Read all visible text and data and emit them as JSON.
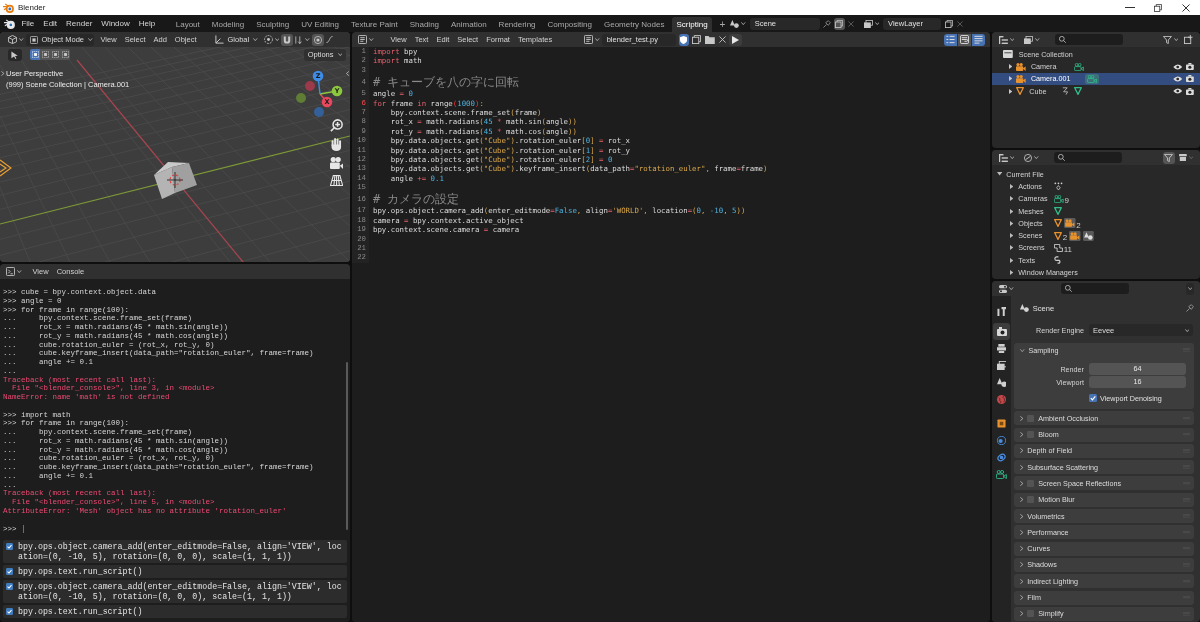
{
  "window": {
    "title": "Blender"
  },
  "menu": [
    "File",
    "Edit",
    "Render",
    "Window",
    "Help"
  ],
  "workspaces": [
    {
      "label": "Layout",
      "selected": false
    },
    {
      "label": "Modeling",
      "selected": false
    },
    {
      "label": "Sculpting",
      "selected": false
    },
    {
      "label": "UV Editing",
      "selected": false
    },
    {
      "label": "Texture Paint",
      "selected": false
    },
    {
      "label": "Shading",
      "selected": false
    },
    {
      "label": "Animation",
      "selected": false
    },
    {
      "label": "Rendering",
      "selected": false
    },
    {
      "label": "Compositing",
      "selected": false
    },
    {
      "label": "Geometry Nodes",
      "selected": false
    },
    {
      "label": "Scripting",
      "selected": true
    }
  ],
  "add_workspace": "+",
  "scene": {
    "name": "Scene"
  },
  "view_layer": {
    "name": "ViewLayer"
  },
  "viewport": {
    "mode": "Object Mode",
    "menus": [
      "View",
      "Select",
      "Add",
      "Object"
    ],
    "orientation": "Global",
    "options": "Options",
    "select_modes": [
      {
        "selected": true
      },
      {
        "selected": false
      },
      {
        "selected": false
      },
      {
        "selected": false
      }
    ],
    "overlay_lines": [
      "User Perspective",
      "(999) Scene Collection | Camera.001"
    ],
    "gizmo": [
      {
        "kind": "negative",
        "color": "#9a3a4a"
      },
      {
        "kind": "negative",
        "color": "#5f7d35"
      },
      {
        "kind": "negative",
        "color": "#34609a"
      },
      {
        "kind": "positive",
        "label": "X",
        "color": "#e8475e"
      },
      {
        "kind": "positive",
        "label": "Y",
        "color": "#8dc63f"
      },
      {
        "kind": "positive",
        "label": "Z",
        "color": "#3d8ce6"
      }
    ]
  },
  "console": {
    "menus": [
      "View",
      "Console"
    ],
    "lines": [
      {
        "kind": "input",
        "text": ">>> cube = bpy.context.object.data"
      },
      {
        "kind": "input",
        "text": ">>> angle = 0"
      },
      {
        "kind": "input",
        "text": ">>> for frame in range(100):"
      },
      {
        "kind": "input",
        "text": "...     bpy.context.scene.frame_set(frame)"
      },
      {
        "kind": "input",
        "text": "...     rot_x = math.radians(45 * math.sin(angle))"
      },
      {
        "kind": "input",
        "text": "...     rot_y = math.radians(45 * math.cos(angle))"
      },
      {
        "kind": "input",
        "text": "...     cube.rotation_euler = (rot_x, rot_y, 0)"
      },
      {
        "kind": "input",
        "text": "...     cube.keyframe_insert(data_path=\"rotation_euler\", frame=frame)"
      },
      {
        "kind": "input",
        "text": "...     angle += 0.1"
      },
      {
        "kind": "input",
        "text": "..."
      },
      {
        "kind": "error",
        "text": "Traceback (most recent call last):"
      },
      {
        "kind": "error",
        "text": "  File \"<blender_console>\", line 3, in <module>"
      },
      {
        "kind": "error",
        "text": "NameError: name 'math' is not defined"
      },
      {
        "kind": "blank"
      },
      {
        "kind": "input",
        "text": ">>> import math"
      },
      {
        "kind": "input",
        "text": ">>> for frame in range(100):"
      },
      {
        "kind": "input",
        "text": "...     bpy.context.scene.frame_set(frame)"
      },
      {
        "kind": "input",
        "text": "...     rot_x = math.radians(45 * math.sin(angle))"
      },
      {
        "kind": "input",
        "text": "...     rot_y = math.radians(45 * math.cos(angle))"
      },
      {
        "kind": "input",
        "text": "...     cube.rotation_euler = (rot_x, rot_y, 0)"
      },
      {
        "kind": "input",
        "text": "...     cube.keyframe_insert(data_path=\"rotation_euler\", frame=frame)"
      },
      {
        "kind": "input",
        "text": "...     angle += 0.1"
      },
      {
        "kind": "input",
        "text": "..."
      },
      {
        "kind": "error",
        "text": "Traceback (most recent call last):"
      },
      {
        "kind": "error",
        "text": "  File \"<blender_console>\", line 5, in <module>"
      },
      {
        "kind": "error",
        "text": "AttributeError: 'Mesh' object has no attribute 'rotation_euler'"
      },
      {
        "kind": "blank"
      }
    ],
    "prompt": ">>>"
  },
  "info": {
    "reports": [
      {
        "text": "bpy.ops.object.camera_add(enter_editmode=False, align='VIEW', location=(0, -10, 5), rotation=(0, 0, 0), scale=(1, 1, 1))"
      },
      {
        "text": "bpy.ops.text.run_script()"
      },
      {
        "text": "bpy.ops.object.camera_add(enter_editmode=False, align='VIEW', location=(0, -10, 5), rotation=(0, 0, 0), scale=(1, 1, 1))"
      },
      {
        "text": "bpy.ops.text.run_script()"
      }
    ]
  },
  "text_editor": {
    "menus": [
      "View",
      "Text",
      "Edit",
      "Select",
      "Format",
      "Templates"
    ],
    "file_name": "blender_test.py",
    "toggles": [
      {
        "kind": "line_numbers",
        "selected": true
      },
      {
        "kind": "word_wrap",
        "selected": false
      },
      {
        "kind": "syntax",
        "selected": true
      }
    ],
    "lines": [
      {
        "number": "1",
        "current": false,
        "tokens": [
          {
            "kind": "keyword",
            "text": "import"
          },
          {
            "kind": "plain",
            "text": " bpy"
          }
        ]
      },
      {
        "number": "2",
        "current": false,
        "tokens": [
          {
            "kind": "keyword",
            "text": "import"
          },
          {
            "kind": "plain",
            "text": " math"
          }
        ]
      },
      {
        "number": "3",
        "current": false
      },
      {
        "number": "4",
        "current": false,
        "tokens": [
          {
            "kind": "comment",
            "text": "# キューブを八の字に回転"
          }
        ]
      },
      {
        "number": "5",
        "current": false,
        "tokens": [
          {
            "kind": "plain",
            "text": "angle "
          },
          {
            "kind": "operator",
            "text": "="
          },
          {
            "kind": "number",
            "text": " 0"
          }
        ]
      },
      {
        "number": "6",
        "current": true,
        "tokens": [
          {
            "kind": "keyword",
            "text": "for"
          },
          {
            "kind": "plain",
            "text": " frame "
          },
          {
            "kind": "keyword",
            "text": "in"
          },
          {
            "kind": "plain",
            "text": " range"
          },
          {
            "kind": "match",
            "text": "("
          },
          {
            "kind": "number",
            "text": "1000"
          },
          {
            "kind": "match",
            "text": ")"
          },
          {
            "kind": "punct",
            "text": ":"
          }
        ]
      },
      {
        "number": "7",
        "current": false,
        "tokens": [
          {
            "kind": "plain",
            "text": "    bpy.context.scene.frame_set"
          },
          {
            "kind": "punct",
            "text": "("
          },
          {
            "kind": "plain",
            "text": "frame"
          },
          {
            "kind": "punct",
            "text": ")"
          }
        ]
      },
      {
        "number": "8",
        "current": false,
        "tokens": [
          {
            "kind": "plain",
            "text": "    rot_x "
          },
          {
            "kind": "operator",
            "text": "="
          },
          {
            "kind": "plain",
            "text": " math.radians"
          },
          {
            "kind": "punct",
            "text": "("
          },
          {
            "kind": "number",
            "text": "45"
          },
          {
            "kind": "operator",
            "text": " *"
          },
          {
            "kind": "plain",
            "text": " math.sin"
          },
          {
            "kind": "punct",
            "text": "("
          },
          {
            "kind": "plain",
            "text": "angle"
          },
          {
            "kind": "punct",
            "text": "))"
          }
        ]
      },
      {
        "number": "9",
        "current": false,
        "tokens": [
          {
            "kind": "plain",
            "text": "    rot_y "
          },
          {
            "kind": "operator",
            "text": "="
          },
          {
            "kind": "plain",
            "text": " math.radians"
          },
          {
            "kind": "punct",
            "text": "("
          },
          {
            "kind": "number",
            "text": "45"
          },
          {
            "kind": "operator",
            "text": " *"
          },
          {
            "kind": "plain",
            "text": " math.cos"
          },
          {
            "kind": "punct",
            "text": "("
          },
          {
            "kind": "plain",
            "text": "angle"
          },
          {
            "kind": "punct",
            "text": "))"
          }
        ]
      },
      {
        "number": "10",
        "current": false,
        "tokens": [
          {
            "kind": "plain",
            "text": "    bpy.data.objects.get"
          },
          {
            "kind": "punct",
            "text": "("
          },
          {
            "kind": "string",
            "text": "\"Cube\""
          },
          {
            "kind": "punct",
            "text": ")"
          },
          {
            "kind": "plain",
            "text": ".rotation_euler"
          },
          {
            "kind": "punct",
            "text": "["
          },
          {
            "kind": "number",
            "text": "0"
          },
          {
            "kind": "punct",
            "text": "]"
          },
          {
            "kind": "operator",
            "text": " ="
          },
          {
            "kind": "plain",
            "text": " rot_x"
          }
        ]
      },
      {
        "number": "11",
        "current": false,
        "tokens": [
          {
            "kind": "plain",
            "text": "    bpy.data.objects.get"
          },
          {
            "kind": "punct",
            "text": "("
          },
          {
            "kind": "string",
            "text": "\"Cube\""
          },
          {
            "kind": "punct",
            "text": ")"
          },
          {
            "kind": "plain",
            "text": ".rotation_euler"
          },
          {
            "kind": "punct",
            "text": "["
          },
          {
            "kind": "number",
            "text": "1"
          },
          {
            "kind": "punct",
            "text": "]"
          },
          {
            "kind": "operator",
            "text": " ="
          },
          {
            "kind": "plain",
            "text": " rot_y"
          }
        ]
      },
      {
        "number": "12",
        "current": false,
        "tokens": [
          {
            "kind": "plain",
            "text": "    bpy.data.objects.get"
          },
          {
            "kind": "punct",
            "text": "("
          },
          {
            "kind": "string",
            "text": "\"Cube\""
          },
          {
            "kind": "punct",
            "text": ")"
          },
          {
            "kind": "plain",
            "text": ".rotation_euler"
          },
          {
            "kind": "punct",
            "text": "["
          },
          {
            "kind": "number",
            "text": "2"
          },
          {
            "kind": "punct",
            "text": "]"
          },
          {
            "kind": "operator",
            "text": " ="
          },
          {
            "kind": "number",
            "text": " 0"
          }
        ]
      },
      {
        "number": "13",
        "current": false,
        "tokens": [
          {
            "kind": "plain",
            "text": "    bpy.data.objects.get"
          },
          {
            "kind": "punct",
            "text": "("
          },
          {
            "kind": "string",
            "text": "\"Cube\""
          },
          {
            "kind": "punct",
            "text": ")"
          },
          {
            "kind": "plain",
            "text": ".keyframe_insert"
          },
          {
            "kind": "punct",
            "text": "("
          },
          {
            "kind": "plain",
            "text": "data_path"
          },
          {
            "kind": "operator",
            "text": "="
          },
          {
            "kind": "string",
            "text": "\"rotation_euler\""
          },
          {
            "kind": "punct",
            "text": ","
          },
          {
            "kind": "plain",
            "text": " frame"
          },
          {
            "kind": "operator",
            "text": "="
          },
          {
            "kind": "plain",
            "text": "frame"
          },
          {
            "kind": "punct",
            "text": ")"
          }
        ]
      },
      {
        "number": "14",
        "current": false,
        "tokens": [
          {
            "kind": "plain",
            "text": "    angle "
          },
          {
            "kind": "operator",
            "text": "+="
          },
          {
            "kind": "number",
            "text": " 0.1"
          }
        ]
      },
      {
        "number": "15",
        "current": false
      },
      {
        "number": "16",
        "current": false,
        "tokens": [
          {
            "kind": "comment",
            "text": "# カメラの設定"
          }
        ]
      },
      {
        "number": "17",
        "current": false,
        "tokens": [
          {
            "kind": "plain",
            "text": "bpy.ops.object.camera_add"
          },
          {
            "kind": "punct",
            "text": "("
          },
          {
            "kind": "plain",
            "text": "enter_editmode"
          },
          {
            "kind": "operator",
            "text": "="
          },
          {
            "kind": "constant",
            "text": "False"
          },
          {
            "kind": "punct",
            "text": ","
          },
          {
            "kind": "plain",
            "text": " align"
          },
          {
            "kind": "operator",
            "text": "="
          },
          {
            "kind": "string",
            "text": "'WORLD'"
          },
          {
            "kind": "punct",
            "text": ","
          },
          {
            "kind": "plain",
            "text": " location"
          },
          {
            "kind": "operator",
            "text": "="
          },
          {
            "kind": "punct",
            "text": "("
          },
          {
            "kind": "number",
            "text": "0"
          },
          {
            "kind": "punct",
            "text": ","
          },
          {
            "kind": "number",
            "text": " -10"
          },
          {
            "kind": "punct",
            "text": ","
          },
          {
            "kind": "number",
            "text": " 5"
          },
          {
            "kind": "punct",
            "text": "))"
          }
        ]
      },
      {
        "number": "18",
        "current": false,
        "tokens": [
          {
            "kind": "plain",
            "text": "camera "
          },
          {
            "kind": "operator",
            "text": "="
          },
          {
            "kind": "plain",
            "text": " bpy.context.active_object"
          }
        ]
      },
      {
        "number": "19",
        "current": false,
        "tokens": [
          {
            "kind": "plain",
            "text": "bpy.context.scene.camera "
          },
          {
            "kind": "operator",
            "text": "="
          },
          {
            "kind": "plain",
            "text": " camera"
          }
        ]
      },
      {
        "number": "20",
        "current": false
      },
      {
        "number": "21",
        "current": false
      },
      {
        "number": "22",
        "current": false
      }
    ]
  },
  "outliner": {
    "root": {
      "label": "Scene Collection",
      "children": [
        {
          "label": "Camera",
          "kind": "camera",
          "selected": false,
          "expanded": false,
          "animated": false
        },
        {
          "label": "Camera.001",
          "kind": "camera",
          "selected": true,
          "expanded": false,
          "animated": false
        },
        {
          "label": "Cube",
          "kind": "mesh",
          "selected": false,
          "expanded": false,
          "animated": true
        }
      ]
    }
  },
  "blend_file": {
    "root": {
      "label": "Current File",
      "expanded": true,
      "children": [
        {
          "label": "Actions",
          "expanded": false,
          "icons": [
            {
              "kind": "action"
            }
          ]
        },
        {
          "label": "Cameras",
          "expanded": false,
          "icons": [
            {
              "kind": "camera_data",
              "count": "9"
            }
          ]
        },
        {
          "label": "Meshes",
          "expanded": false,
          "icons": [
            {
              "kind": "mesh_data"
            }
          ]
        },
        {
          "label": "Objects",
          "expanded": false,
          "icons": [
            {
              "kind": "mesh_object"
            },
            {
              "kind": "camera_object",
              "count": "2"
            }
          ]
        },
        {
          "label": "Scenes",
          "expanded": false,
          "icons": [
            {
              "kind": "mesh_object",
              "count": "2"
            },
            {
              "kind": "camera_object"
            },
            {
              "kind": "scene"
            }
          ]
        },
        {
          "label": "Screens",
          "expanded": false,
          "icons": [
            {
              "kind": "screen",
              "count": "11"
            }
          ]
        },
        {
          "label": "Texts",
          "expanded": false,
          "icons": [
            {
              "kind": "text"
            }
          ]
        },
        {
          "label": "Window Managers",
          "expanded": false
        }
      ]
    }
  },
  "properties": {
    "tabs": [
      {
        "kind": "tool",
        "selected": false
      },
      {
        "kind": "render",
        "selected": true
      },
      {
        "kind": "output",
        "selected": false
      },
      {
        "kind": "view_layer",
        "selected": false
      },
      {
        "kind": "scene",
        "selected": false
      },
      {
        "kind": "world",
        "selected": false
      },
      {
        "kind": "object",
        "selected": false
      },
      {
        "kind": "physics",
        "selected": false
      },
      {
        "kind": "constraints",
        "selected": false
      },
      {
        "kind": "data",
        "selected": false
      }
    ],
    "title": "Scene",
    "render_engine": {
      "label": "Render Engine",
      "value": "Eevee"
    },
    "panels": [
      {
        "title": "Sampling",
        "kind": "plain",
        "expanded": true,
        "fields": [
          {
            "label": "Render",
            "value": "64"
          },
          {
            "label": "Viewport",
            "value": "16"
          }
        ],
        "option": {
          "label": "Viewport Denoising",
          "checked": true
        }
      },
      {
        "title": "Ambient Occlusion",
        "kind": "toggle",
        "checked": false,
        "expanded": false
      },
      {
        "title": "Bloom",
        "kind": "toggle",
        "checked": false,
        "expanded": false
      },
      {
        "title": "Depth of Field",
        "kind": "plain",
        "expanded": false
      },
      {
        "title": "Subsurface Scattering",
        "kind": "plain",
        "expanded": false
      },
      {
        "title": "Screen Space Reflections",
        "kind": "toggle",
        "checked": false,
        "expanded": false
      },
      {
        "title": "Motion Blur",
        "kind": "toggle",
        "checked": false,
        "expanded": false
      },
      {
        "title": "Volumetrics",
        "kind": "plain",
        "expanded": false
      },
      {
        "title": "Performance",
        "kind": "plain",
        "expanded": false
      },
      {
        "title": "Curves",
        "kind": "plain",
        "expanded": false
      },
      {
        "title": "Shadows",
        "kind": "plain",
        "expanded": false
      },
      {
        "title": "Indirect Lighting",
        "kind": "plain",
        "expanded": false
      },
      {
        "title": "Film",
        "kind": "plain",
        "expanded": false
      },
      {
        "title": "Simplify",
        "kind": "toggle",
        "checked": false,
        "expanded": false
      }
    ]
  }
}
